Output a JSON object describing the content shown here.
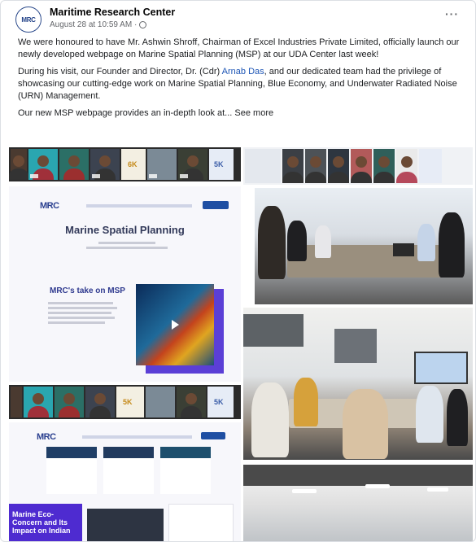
{
  "post": {
    "page_name": "Maritime Research Center",
    "avatar_text": "MRC",
    "timestamp": "August 28 at 10:59 AM ·",
    "more": "···",
    "paragraph1": "We were honoured to have Mr. Ashwin Shroff, Chairman of Excel Industries Private Limited, officially launch our newly developed webpage on Marine Spatial Planning (MSP) at our UDA Center last week!",
    "paragraph2_before": "During his visit, our Founder and Director, Dr. (Cdr) ",
    "paragraph2_link": "Arnab Das",
    "paragraph2_after": ", and our dedicated team had the privilege of showcasing our cutting-edge work on Marine Spatial Planning, Blue Economy, and Underwater Radiated Noise (URN) Management.",
    "paragraph3": "Our new MSP webpage provides an in-depth look at...",
    "see_more": "See more"
  },
  "media": {
    "strip_counts": [
      "6K",
      "5K",
      "5K",
      "5K"
    ],
    "webpage1": {
      "logo": "MRC",
      "title": "Marine Spatial Planning",
      "section_title": "MRC's take on MSP"
    },
    "webpage2": {
      "logo": "MRC",
      "banner_lines": [
        "Marine Eco-",
        "Concern and Its",
        "Impact on Indian"
      ]
    }
  },
  "colors": {
    "link": "#1d55b5",
    "brand": "#2a3f8f",
    "accent_purple": "#5b3fd6"
  }
}
